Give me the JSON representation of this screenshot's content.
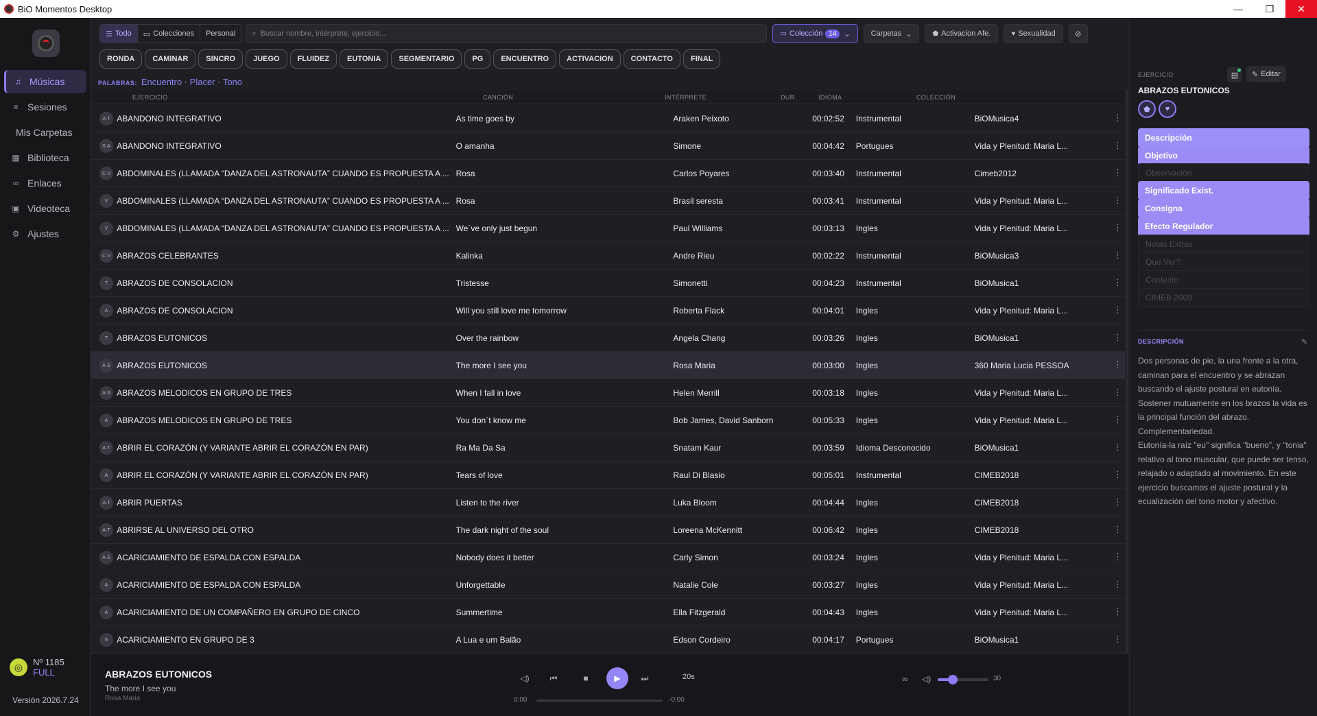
{
  "window": {
    "title": "BiO Momentos Desktop",
    "minimize": "—",
    "maximize": "❐",
    "close": "✕"
  },
  "sidebar": {
    "items": [
      {
        "label": "Músicas",
        "icon": "♫"
      },
      {
        "label": "Sesiones",
        "icon": "≡"
      },
      {
        "label": "Mis Carpetas",
        "icon": ""
      },
      {
        "label": "Biblioteca",
        "icon": "▦"
      },
      {
        "label": "Enlaces",
        "icon": "∞"
      },
      {
        "label": "Videoteca",
        "icon": "▣"
      },
      {
        "label": "Ajustes",
        "icon": "⚙"
      }
    ],
    "license_number": "Nº 1185",
    "license_plan": "FULL",
    "version": "Versión 2026.7.24"
  },
  "toolbar": {
    "scope": [
      {
        "label": "Todo",
        "icon": "☰"
      },
      {
        "label": "Colecciones",
        "icon": "▭"
      },
      {
        "label": "Personal",
        "icon": ""
      }
    ],
    "search_placeholder": "Buscar nombre, intérprete, ejercicio...",
    "coleccion_label": "Colección",
    "coleccion_count": "14",
    "carpetas_label": "Carpetas",
    "activacion_label": "Activacion Afe.",
    "sexualidad_label": "Sexualidad"
  },
  "categories": [
    "RONDA",
    "CAMINAR",
    "SINCRO",
    "JUEGO",
    "FLUIDEZ",
    "EUTONIA",
    "SEGMENTARIO",
    "PG",
    "ENCUENTRO",
    "ACTIVACION",
    "CONTACTO",
    "FINAL"
  ],
  "keywords": {
    "label": "PALABRAS:",
    "words": "Encuentro · Placer · Tono"
  },
  "table": {
    "headers": {
      "ejercicio": "EJERCICIO",
      "cancion": "CANCIÓN",
      "interprete": "INTÉRPRETE",
      "dur": "DUR.",
      "idioma": "IDIOMA",
      "coleccion": "COLECCIÓN"
    },
    "rows": [
      {
        "av": "A·T",
        "ejercicio": "ABANDONO INTEGRATIVO",
        "cancion": "As time goes by",
        "interprete": "Araken Peixoto",
        "dur": "00:02:52",
        "idioma": "Instrumental",
        "coleccion": "BiOMusica4"
      },
      {
        "av": "S·A",
        "ejercicio": "ABANDONO INTEGRATIVO",
        "cancion": "O amanha",
        "interprete": "Simone",
        "dur": "00:04:42",
        "idioma": "Portugues",
        "coleccion": "Vida y Plenitud: Maria L..."
      },
      {
        "av": "C·V",
        "ejercicio": "ABDOMINALES (LLAMADA “DANZA DEL ASTRONAUTA” CUANDO ES PROPUESTA A ...",
        "cancion": "Rosa",
        "interprete": "Carlos Poyares",
        "dur": "00:03:40",
        "idioma": "Instrumental",
        "coleccion": "Cimeb2012"
      },
      {
        "av": "V",
        "ejercicio": "ABDOMINALES (LLAMADA “DANZA DEL ASTRONAUTA” CUANDO ES PROPUESTA A ...",
        "cancion": "Rosa",
        "interprete": "Brasil seresta",
        "dur": "00:03:41",
        "idioma": "Instrumental",
        "coleccion": "Vida y Plenitud: Maria L..."
      },
      {
        "av": "V",
        "ejercicio": "ABDOMINALES (LLAMADA “DANZA DEL ASTRONAUTA” CUANDO ES PROPUESTA A ...",
        "cancion": "We´ve only just begun",
        "interprete": "Paul Williams",
        "dur": "00:03:13",
        "idioma": "Ingles",
        "coleccion": "Vida y Plenitud: Maria L..."
      },
      {
        "av": "C·V",
        "ejercicio": "ABRAZOS CELEBRANTES",
        "cancion": "Kalinka",
        "interprete": "Andre Rieu",
        "dur": "00:02:22",
        "idioma": "Instrumental",
        "coleccion": "BiOMusica3"
      },
      {
        "av": "T",
        "ejercicio": "ABRAZOS DE CONSOLACION",
        "cancion": "Tristesse",
        "interprete": "Simonetti",
        "dur": "00:04:23",
        "idioma": "Instrumental",
        "coleccion": "BiOMusica1"
      },
      {
        "av": "A",
        "ejercicio": "ABRAZOS DE CONSOLACION",
        "cancion": "Will you still love me tomorrow",
        "interprete": "Roberta Flack",
        "dur": "00:04:01",
        "idioma": "Ingles",
        "coleccion": "Vida y Plenitud: Maria L..."
      },
      {
        "av": "T",
        "ejercicio": "ABRAZOS EUTONICOS",
        "cancion": "Over the rainbow",
        "interprete": "Angela Chang",
        "dur": "00:03:26",
        "idioma": "Ingles",
        "coleccion": "BiOMusica1"
      },
      {
        "av": "A·S",
        "ejercicio": "ABRAZOS EUTONICOS",
        "cancion": "The more I see you",
        "interprete": "Rosa Maria",
        "dur": "00:03:00",
        "idioma": "Ingles",
        "coleccion": "360 Maria Lucia PESSOA"
      },
      {
        "av": "A·S",
        "ejercicio": "ABRAZOS MELODICOS EN GRUPO DE TRES",
        "cancion": "When I fall in love",
        "interprete": "Helen Merrill",
        "dur": "00:03:18",
        "idioma": "Ingles",
        "coleccion": "Vida y Plenitud: Maria L..."
      },
      {
        "av": "A",
        "ejercicio": "ABRAZOS MELODICOS EN GRUPO DE TRES",
        "cancion": "You don´t know me",
        "interprete": "Bob James, David Sanborn",
        "dur": "00:05:33",
        "idioma": "Ingles",
        "coleccion": "Vida y Plenitud: Maria L..."
      },
      {
        "av": "A·T",
        "ejercicio": "ABRIR EL CORAZÓN (Y VARIANTE ABRIR EL CORAZÓN EN PAR)",
        "cancion": "Ra Ma Da Sa",
        "interprete": "Snatam Kaur",
        "dur": "00:03:59",
        "idioma": "Idioma Desconocido",
        "coleccion": "BiOMusica1"
      },
      {
        "av": "A",
        "ejercicio": "ABRIR EL CORAZÓN (Y VARIANTE ABRIR EL CORAZÓN EN PAR)",
        "cancion": "Tears of love",
        "interprete": "Raul Di Blasio",
        "dur": "00:05:01",
        "idioma": "Instrumental",
        "coleccion": "CIMEB2018"
      },
      {
        "av": "A·T",
        "ejercicio": "ABRIR PUERTAS",
        "cancion": "Listen to the river",
        "interprete": "Luka Bloom",
        "dur": "00:04:44",
        "idioma": "Ingles",
        "coleccion": "CIMEB2018"
      },
      {
        "av": "A·T",
        "ejercicio": "ABRIRSE AL UNIVERSO DEL OTRO",
        "cancion": "The dark night of the soul",
        "interprete": "Loreena McKennitt",
        "dur": "00:06:42",
        "idioma": "Ingles",
        "coleccion": "CIMEB2018"
      },
      {
        "av": "A·S",
        "ejercicio": "ACARICIAMIENTO DE ESPALDA CON ESPALDA",
        "cancion": "Nobody does it better",
        "interprete": "Carly Simon",
        "dur": "00:03:24",
        "idioma": "Ingles",
        "coleccion": "Vida y Plenitud: Maria L..."
      },
      {
        "av": "A",
        "ejercicio": "ACARICIAMIENTO DE ESPALDA CON ESPALDA",
        "cancion": "Unforgettable",
        "interprete": "Natalie Cole",
        "dur": "00:03:27",
        "idioma": "Ingles",
        "coleccion": "Vida y Plenitud: Maria L..."
      },
      {
        "av": "A",
        "ejercicio": "ACARICIAMIENTO DE UN COMPAÑERO EN GRUPO DE CINCO",
        "cancion": "Summertime",
        "interprete": "Ella Fitzgerald",
        "dur": "00:04:43",
        "idioma": "Ingles",
        "coleccion": "Vida y Plenitud: Maria L..."
      },
      {
        "av": "S",
        "ejercicio": "ACARICIAMIENTO EN GRUPO DE 3",
        "cancion": "A Lua e um Balão",
        "interprete": "Edson Cordeiro",
        "dur": "00:04:17",
        "idioma": "Portugues",
        "coleccion": "BiOMusica1"
      }
    ]
  },
  "player": {
    "title": "ABRAZOS EUTONICOS",
    "song": "The more I see you",
    "artist": "Rosa Maria",
    "skip": "20s",
    "time_elapsed": "0:00",
    "time_remaining": "-0:00",
    "volume": "30"
  },
  "panel": {
    "label": "EJERCICIO",
    "edit": "Editar",
    "title": "ABRAZOS EUTONICOS",
    "sections_on": [
      "Descripción",
      "Objetivo"
    ],
    "section_observacion": "Observación",
    "sections_on2": [
      "Significado Exist.",
      "Consigna",
      "Efecto Regulador"
    ],
    "sections_off": [
      "Notas Extras",
      "Que Ver?",
      "Contexto",
      "CIMEB 2009"
    ],
    "desc_label": "DESCRIPCIÓN",
    "description": "Dos personas de pie, la una frente a la otra, caminan para el encuentro y se abrazan buscando el ajuste postural en eutonía. Sostener mutuamente en los brazos la vida es la principal función del abrazo. Complementariedad.\nEutonía-la raíz \"eu\" significa \"bueno\", y \"tonia\" relativo al tono muscular, que puede ser tenso, relajado o adaptado al movimiento. En este ejercicio buscamos el ajuste postural y la ecualización del tono motor y afectivo."
  },
  "colors": {
    "accent": "#8b7cf6",
    "background": "#1f1f23",
    "sidebar": "#17171a"
  }
}
